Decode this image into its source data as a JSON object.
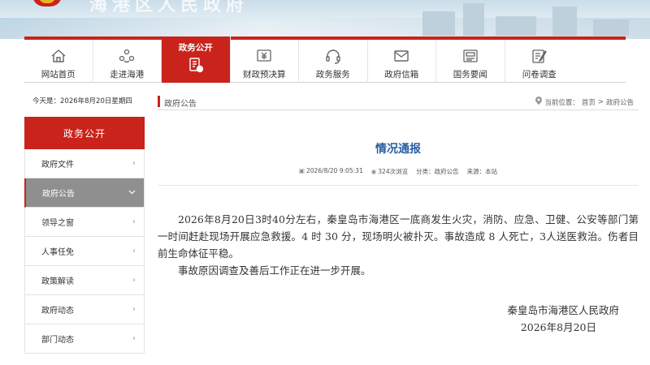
{
  "banner": {
    "title": "海港区人民政府"
  },
  "nav": {
    "items": [
      {
        "label": "网站首页",
        "icon": "home-icon"
      },
      {
        "label": "走进海港",
        "icon": "people-icon"
      },
      {
        "label": "政务公开",
        "icon": "document-icon",
        "active": true
      },
      {
        "label": "财政预决算",
        "icon": "finance-icon"
      },
      {
        "label": "政务服务",
        "icon": "headset-icon"
      },
      {
        "label": "政府信箱",
        "icon": "mail-icon"
      },
      {
        "label": "国务要闻",
        "icon": "news-icon"
      },
      {
        "label": "问卷调查",
        "icon": "survey-icon"
      }
    ]
  },
  "date_text": "今天是：2026年8月20日星期四",
  "sidebar": {
    "title": "政务公开",
    "items": [
      {
        "label": "政府文件",
        "active": false
      },
      {
        "label": "政府公告",
        "active": true
      },
      {
        "label": "领导之窗",
        "active": false
      },
      {
        "label": "人事任免",
        "active": false
      },
      {
        "label": "政策解读",
        "active": false
      },
      {
        "label": "政府动态",
        "active": false
      },
      {
        "label": "部门动态",
        "active": false
      }
    ]
  },
  "breadcrumb": {
    "section": "政府公告",
    "prefix": "当前位置：",
    "home": "首页",
    "sep": ">",
    "current": "政府公告"
  },
  "article": {
    "title": "情况通报",
    "datetime": "2026/8/20 9:05:31",
    "views": "324次浏览",
    "category": "分类：政府公告",
    "source": "来源：本站",
    "paragraphs": [
      "2026年8月20日3时40分左右，秦皇岛市海港区一底商发生火灾，消防、应急、卫健、公安等部门第一时间赶赴现场开展应急救援。4 时 30 分，现场明火被扑灭。事故造成 8 人死亡，3人送医救治。伤者目前生命体征平稳。",
      "事故原因调查及善后工作正在进一步开展。"
    ],
    "signature": "秦皇岛市海港区人民政府",
    "sign_date": "2026年8月20日"
  },
  "colors": {
    "accent": "#c9231b",
    "title_blue": "#2b5fa0"
  }
}
